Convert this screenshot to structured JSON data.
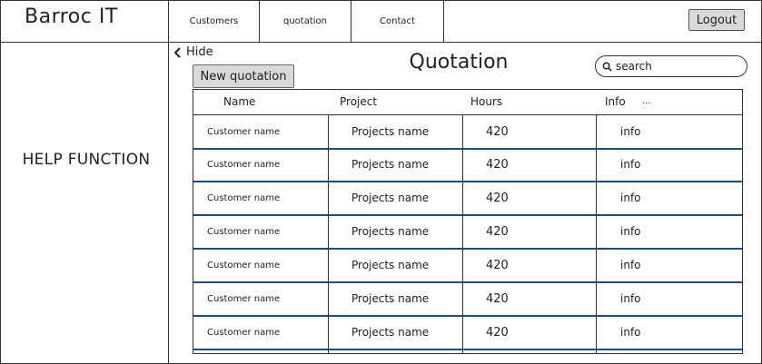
{
  "header": {
    "logo": "Barroc IT",
    "nav": [
      "Customers",
      "quotation",
      "Contact"
    ],
    "logout_label": "Logout"
  },
  "sidebar": {
    "help_label": "HELP FUNCTION"
  },
  "main": {
    "hide_label": "Hide",
    "new_button_label": "New quotation",
    "title": "Quotation",
    "search_placeholder": "search",
    "table": {
      "columns": [
        "Name",
        "Project",
        "Hours",
        "Info",
        "..."
      ],
      "rows": [
        {
          "name": "Customer name",
          "project": "Projects name",
          "hours": "420",
          "info": "info"
        },
        {
          "name": "Customer name",
          "project": "Projects name",
          "hours": "420",
          "info": "info"
        },
        {
          "name": "Customer name",
          "project": "Projects name",
          "hours": "420",
          "info": "info"
        },
        {
          "name": "Customer name",
          "project": "Projects name",
          "hours": "420",
          "info": "info"
        },
        {
          "name": "Customer name",
          "project": "Projects name",
          "hours": "420",
          "info": "info"
        },
        {
          "name": "Customer name",
          "project": "Projects name",
          "hours": "420",
          "info": "info"
        },
        {
          "name": "Customer name",
          "project": "Projects name",
          "hours": "420",
          "info": "info"
        }
      ]
    }
  },
  "colors": {
    "row_border": "#1f4e79",
    "button_bg": "#d9d9d9"
  }
}
